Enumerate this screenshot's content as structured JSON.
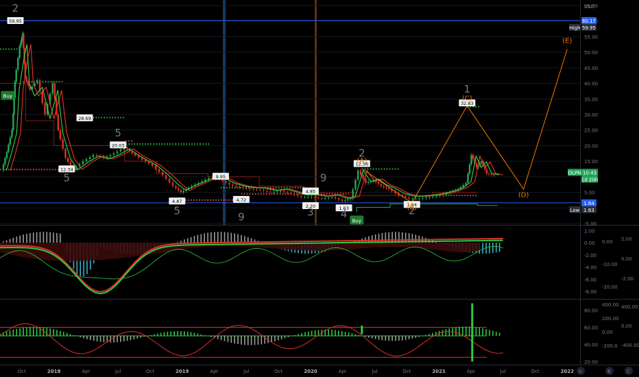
{
  "chart_data": {
    "type": "line",
    "symbol": "DLPN",
    "currency_label": "USD",
    "price": {
      "ylim": [
        -5,
        65
      ],
      "ticks": [
        "65.00",
        "60.00",
        "55.00",
        "50.00",
        "45.00",
        "40.00",
        "35.00",
        "30.00",
        "25.00",
        "20.00",
        "15.00",
        "10.00",
        "5.00",
        "0.00",
        "-5.00"
      ],
      "tick_values": [
        65,
        60,
        55,
        50,
        45,
        40,
        35,
        30,
        25,
        20,
        15,
        10,
        5,
        0,
        -5
      ],
      "high": {
        "label": "High",
        "value": "59.95",
        "level_label": "60.17",
        "level": 60.17
      },
      "low": {
        "label": "Low",
        "value": "1.63",
        "level_label": "1.64",
        "level": 1.64
      },
      "last": {
        "symbol": "DLPN",
        "value": "10.43",
        "sub": "1d 20h"
      },
      "close_series": [
        {
          "t": 2017.6,
          "v": 12.0
        },
        {
          "t": 2017.64,
          "v": 18.0
        },
        {
          "t": 2017.68,
          "v": 25.0
        },
        {
          "t": 2017.7,
          "v": 40.5
        },
        {
          "t": 2017.74,
          "v": 52.0
        },
        {
          "t": 2017.76,
          "v": 56.0
        },
        {
          "t": 2017.78,
          "v": 42.0
        },
        {
          "t": 2017.82,
          "v": 38.0
        },
        {
          "t": 2017.88,
          "v": 41.0
        },
        {
          "t": 2017.94,
          "v": 30.0
        },
        {
          "t": 2018.0,
          "v": 40.0
        },
        {
          "t": 2018.04,
          "v": 25.0
        },
        {
          "t": 2018.1,
          "v": 16.0
        },
        {
          "t": 2018.16,
          "v": 12.3
        },
        {
          "t": 2018.24,
          "v": 15.0
        },
        {
          "t": 2018.32,
          "v": 17.0
        },
        {
          "t": 2018.4,
          "v": 16.0
        },
        {
          "t": 2018.48,
          "v": 17.5
        },
        {
          "t": 2018.56,
          "v": 19.5
        },
        {
          "t": 2018.62,
          "v": 17.5
        },
        {
          "t": 2018.7,
          "v": 15.5
        },
        {
          "t": 2018.78,
          "v": 13.5
        },
        {
          "t": 2018.86,
          "v": 10.5
        },
        {
          "t": 2018.94,
          "v": 7.0
        },
        {
          "t": 2019.0,
          "v": 5.0
        },
        {
          "t": 2019.06,
          "v": 6.5
        },
        {
          "t": 2019.14,
          "v": 8.0
        },
        {
          "t": 2019.22,
          "v": 9.5
        },
        {
          "t": 2019.3,
          "v": 9.3
        },
        {
          "t": 2019.38,
          "v": 7.5
        },
        {
          "t": 2019.46,
          "v": 6.5
        },
        {
          "t": 2019.54,
          "v": 6.0
        },
        {
          "t": 2019.62,
          "v": 5.8
        },
        {
          "t": 2019.7,
          "v": 5.0
        },
        {
          "t": 2019.78,
          "v": 5.5
        },
        {
          "t": 2019.86,
          "v": 4.5
        },
        {
          "t": 2019.94,
          "v": 3.5
        },
        {
          "t": 2020.02,
          "v": 3.5
        },
        {
          "t": 2020.1,
          "v": 3.0
        },
        {
          "t": 2020.18,
          "v": 3.5
        },
        {
          "t": 2020.26,
          "v": 2.2
        },
        {
          "t": 2020.32,
          "v": 3.0
        },
        {
          "t": 2020.38,
          "v": 12.0
        },
        {
          "t": 2020.44,
          "v": 8.0
        },
        {
          "t": 2020.5,
          "v": 9.0
        },
        {
          "t": 2020.56,
          "v": 7.0
        },
        {
          "t": 2020.62,
          "v": 6.0
        },
        {
          "t": 2020.7,
          "v": 4.0
        },
        {
          "t": 2020.78,
          "v": 3.0
        },
        {
          "t": 2020.86,
          "v": 3.0
        },
        {
          "t": 2020.94,
          "v": 3.5
        },
        {
          "t": 2021.02,
          "v": 4.0
        },
        {
          "t": 2021.1,
          "v": 5.0
        },
        {
          "t": 2021.16,
          "v": 6.0
        },
        {
          "t": 2021.22,
          "v": 8.0
        },
        {
          "t": 2021.26,
          "v": 17.0
        },
        {
          "t": 2021.3,
          "v": 13.0
        },
        {
          "t": 2021.34,
          "v": 15.0
        },
        {
          "t": 2021.38,
          "v": 11.0
        },
        {
          "t": 2021.44,
          "v": 10.43
        }
      ],
      "projection": [
        {
          "t": 2020.4,
          "v": 12.6
        },
        {
          "t": 2020.79,
          "v": 1.63
        },
        {
          "t": 2021.22,
          "v": 32.8
        },
        {
          "t": 2021.66,
          "v": 6.0
        },
        {
          "t": 2022.0,
          "v": 51.0
        }
      ],
      "price_labels": [
        {
          "text": "59.95",
          "t": 2017.7,
          "v": 59.95
        },
        {
          "text": "28.69",
          "t": 2018.24,
          "v": 28.7
        },
        {
          "text": "20.03",
          "t": 2018.5,
          "v": 20.0
        },
        {
          "text": "12.34",
          "t": 2018.1,
          "v": 12.3
        },
        {
          "text": "9.95",
          "t": 2019.3,
          "v": 9.95
        },
        {
          "text": "4.87",
          "t": 2018.96,
          "v": 2.0
        },
        {
          "text": "4.72",
          "t": 2019.46,
          "v": 2.5
        },
        {
          "text": "4.85",
          "t": 2020.0,
          "v": 5.2
        },
        {
          "text": "2.20",
          "t": 2020.0,
          "v": 0.5
        },
        {
          "text": "1.63",
          "t": 2020.26,
          "v": -0.2
        },
        {
          "text": "12.56",
          "t": 2020.4,
          "v": 14.0
        },
        {
          "text": "1.64",
          "t": 2020.79,
          "v": 0.9
        },
        {
          "text": "32.83",
          "t": 2021.22,
          "v": 33.5
        }
      ],
      "wave_labels": [
        {
          "text": "2",
          "t": 2017.7,
          "v": 63.0
        },
        {
          "text": "5",
          "t": 2018.1,
          "v": 8.5
        },
        {
          "text": "5",
          "t": 2018.5,
          "v": 23.0
        },
        {
          "text": "5",
          "t": 2018.96,
          "v": -2.0
        },
        {
          "text": "9",
          "t": 2019.46,
          "v": -4.0
        },
        {
          "text": "9",
          "t": 2020.1,
          "v": 8.5
        },
        {
          "text": "3",
          "t": 2020.0,
          "v": -2.5
        },
        {
          "text": "4",
          "t": 2020.26,
          "v": -3.0
        },
        {
          "text": "2",
          "t": 2020.4,
          "v": 16.5
        },
        {
          "text": "2",
          "t": 2020.79,
          "v": -2.0
        },
        {
          "text": "1",
          "t": 2021.22,
          "v": 37.0
        }
      ],
      "elliott_labels": [
        {
          "text": "(A)",
          "t": 2020.4,
          "v": 14.5
        },
        {
          "text": "(B)",
          "t": 2020.79,
          "v": -0.5
        },
        {
          "text": "(C)",
          "t": 2021.22,
          "v": 34.5
        },
        {
          "text": "(D)",
          "t": 2021.66,
          "v": 3.5
        },
        {
          "text": "(E)",
          "t": 2022.0,
          "v": 53.0
        }
      ],
      "buy_signals": [
        {
          "text": "Buy",
          "t": 2017.64,
          "v": 36.0
        },
        {
          "text": "Buy",
          "t": 2020.36,
          "v": -4.0
        }
      ]
    },
    "x_axis": {
      "ticks": [
        "Oct",
        "2018",
        "Apr",
        "Jul",
        "Oct",
        "2019",
        "Apr",
        "Jul",
        "Oct",
        "2020",
        "Apr",
        "Jul",
        "Oct",
        "2021",
        "Apr",
        "Jul",
        "Oct",
        "2022"
      ],
      "tick_values": [
        2017.75,
        2018.0,
        2018.25,
        2018.5,
        2018.75,
        2019.0,
        2019.25,
        2019.5,
        2019.75,
        2020.0,
        2020.25,
        2020.5,
        2020.75,
        2021.0,
        2021.25,
        2021.5,
        2021.75,
        2022.0
      ],
      "range": [
        2017.58,
        2022.1
      ]
    },
    "oscillator_1": {
      "ylim": [
        -9,
        2.5
      ],
      "left_ticks": [
        "2.00",
        "0.00",
        "-2.00",
        "-4.00",
        "-6.00",
        "-8.00"
      ],
      "left_values": [
        2,
        0,
        -2,
        -4,
        -6,
        -8
      ],
      "mid_ticks": [
        "0.00",
        "-10.00",
        "-20.00"
      ],
      "right_ticks": [
        "2.00",
        "0.00",
        "-2.00"
      ]
    },
    "oscillator_2": {
      "ylim": [
        18,
        90
      ],
      "left_ticks": [
        "80.00",
        "60.00",
        "40.00",
        "20.00"
      ],
      "left_values": [
        80,
        60,
        40,
        20
      ],
      "mid_ticks": [
        "400.00",
        "200.00",
        "0.00",
        "-200.0"
      ],
      "right_ticks": [
        "400.00",
        "0.00",
        "-400.00"
      ]
    },
    "colors": {
      "up": "#26a69a",
      "down": "#ef5350",
      "high_line": "#2962ff",
      "projection": "#f57c00",
      "wave_label": "#787b86",
      "background": "#000000"
    }
  }
}
